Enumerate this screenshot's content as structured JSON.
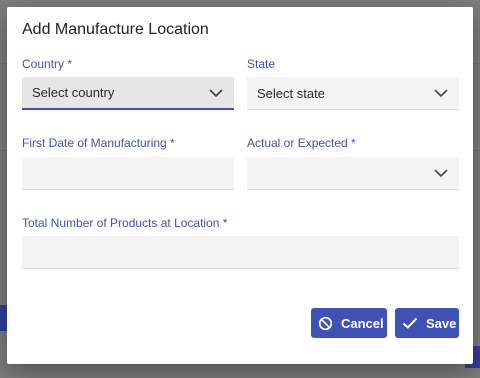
{
  "dialog": {
    "title": "Add Manufacture Location"
  },
  "fields": {
    "country": {
      "label": "Country *",
      "value": "Select country"
    },
    "state": {
      "label": "State",
      "value": "Select state"
    },
    "first_date": {
      "label": "First Date of Manufacturing *",
      "value": ""
    },
    "actual_expected": {
      "label": "Actual or Expected *",
      "value": ""
    },
    "total_products": {
      "label": "Total Number of Products at Location *",
      "value": ""
    }
  },
  "buttons": {
    "cancel_label": "Cancel",
    "save_label": "Save"
  },
  "icons": {
    "cancel": "cancel-circle-icon",
    "save": "checkmark-icon",
    "dropdown": "chevron-down-icon"
  },
  "colors": {
    "accent": "#3f51b5",
    "backdrop": "#7d7d7d",
    "field_bg": "#f3f3f3"
  }
}
